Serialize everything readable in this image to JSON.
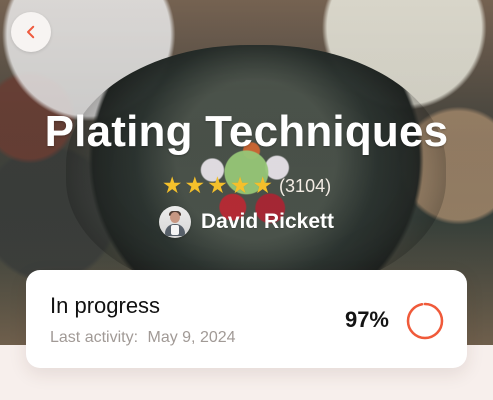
{
  "header": {
    "back_icon": "chevron-left-icon"
  },
  "course": {
    "title": "Plating Techniques",
    "rating_value": 5,
    "rating_count": "(3104)",
    "instructor_name": "David Rickett",
    "instructor_avatar_icon": "avatar-photo"
  },
  "progress": {
    "status_label": "In progress",
    "last_activity_label": "Last activity:",
    "last_activity_date": "May 9, 2024",
    "percent_text": "97%",
    "percent_value": 97,
    "ring_color": "#f05a3a",
    "ring_track_color": "#f5ddd6"
  },
  "colors": {
    "accent": "#f05a3a",
    "star": "#f4c02b",
    "card_background": "#ffffff",
    "page_background": "#f7efec"
  }
}
